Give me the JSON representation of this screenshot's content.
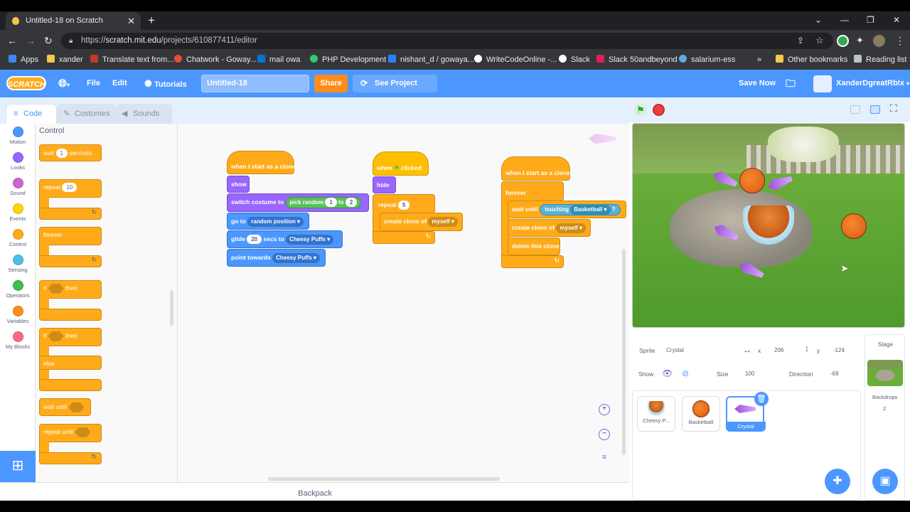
{
  "browser": {
    "tab_title": "Untitled-18 on Scratch",
    "url_host": "scratch.mit.edu",
    "url_path": "/projects/610877411/editor",
    "url_scheme": "https://",
    "bookmarks": [
      "Apps",
      "xander",
      "Translate text from...",
      "Chatwork - Goway...",
      "mail owa",
      "PHP Development",
      "nishant_d / gowaya...",
      "WriteCodeOnline -...",
      "Slack",
      "Slack 50andbeyond",
      "salarium-ess"
    ],
    "other_bookmarks": "Other bookmarks",
    "reading_list": "Reading list",
    "more_bookmarks": "»"
  },
  "menu": {
    "logo": "SCRATCH",
    "file": "File",
    "edit": "Edit",
    "tutorials": "Tutorials",
    "project_title": "Untitled-18",
    "share": "Share",
    "see_project": "See Project Page",
    "save_now": "Save Now",
    "username": "XanderDgreatRblx"
  },
  "editor_tabs": [
    "Code",
    "Costumes",
    "Sounds"
  ],
  "categories": [
    {
      "label": "Motion",
      "color": "#4c97ff"
    },
    {
      "label": "Looks",
      "color": "#9966ff"
    },
    {
      "label": "Sound",
      "color": "#cf63cf"
    },
    {
      "label": "Events",
      "color": "#ffd500"
    },
    {
      "label": "Control",
      "color": "#ffab19"
    },
    {
      "label": "Sensing",
      "color": "#4cbfe6"
    },
    {
      "label": "Operators",
      "color": "#40bf4a"
    },
    {
      "label": "Variables",
      "color": "#ff8c1a"
    },
    {
      "label": "My Blocks",
      "color": "#ff6680"
    }
  ],
  "palette": {
    "header": "Control",
    "wait": "wait",
    "wait_val": "1",
    "seconds": "seconds",
    "repeat": "repeat",
    "repeat_val": "10",
    "forever": "forever",
    "if": "if",
    "then": "then",
    "else": "else",
    "wait_until": "wait until",
    "repeat_until": "repeat until"
  },
  "scripts": {
    "s1": {
      "hat": "when I start as a clone",
      "show": "show",
      "switch_costume": "switch costume to",
      "pick_random": "pick random",
      "pr_from": "1",
      "pr_to_label": "to",
      "pr_to": "2",
      "goto": "go to",
      "goto_target": "random position",
      "glide": "glide",
      "glide_secs": "20",
      "glide_mid": "secs to",
      "glide_target": "Cheesy Puffs",
      "point": "point towards",
      "point_target": "Cheesy Puffs"
    },
    "s2": {
      "hat_when": "when",
      "hat_clicked": "clicked",
      "hide": "hide",
      "repeat": "repeat",
      "repeat_val": "5",
      "create_clone": "create clone of",
      "clone_target": "myself"
    },
    "s3": {
      "hat": "when I start as a clone",
      "forever": "forever",
      "wait_until": "wait until",
      "touching": "touching",
      "touching_target": "Basketball",
      "q": "?",
      "create_clone": "create clone of",
      "clone_target": "myself",
      "delete": "delete this clone"
    }
  },
  "zoom": {
    "in": "+",
    "out": "−",
    "reset": "="
  },
  "backpack": "Backpack",
  "sprite_info": {
    "sprite_label": "Sprite",
    "sprite_name": "Crystal",
    "x_label": "x",
    "x": "206",
    "y_label": "y",
    "y": "-124",
    "show_label": "Show",
    "size_label": "Size",
    "size": "100",
    "direction_label": "Direction",
    "direction": "-69"
  },
  "sprites": [
    {
      "name": "Cheesy P...",
      "selected": false
    },
    {
      "name": "Basketball",
      "selected": false
    },
    {
      "name": "Crystal",
      "selected": true
    }
  ],
  "stage_panel": {
    "label": "Stage",
    "backdrops_label": "Backdrops",
    "backdrops": "2"
  }
}
